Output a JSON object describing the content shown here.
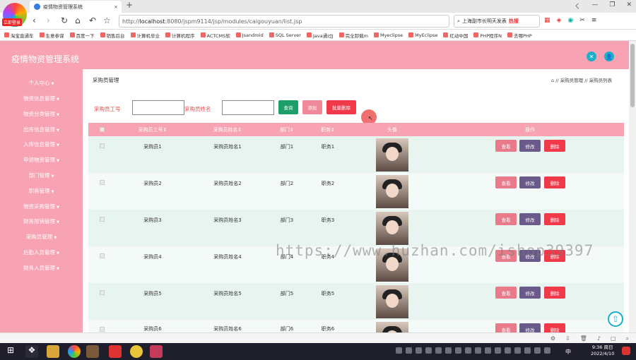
{
  "browser": {
    "tab_title": "疫情物资管理系统",
    "tab_close": "×",
    "new_tab": "+",
    "logo_label": "立即登录",
    "url_prefix": "http://",
    "url_host": "localhost",
    "url_rest": ":8080/jspm9114/jsp/modules/caigouyuan/list.jsp",
    "search_text": "上海副市长明天发表",
    "search_badge": "热搜",
    "window_controls": [
      "ㄑ",
      "—",
      "❐",
      "✕"
    ],
    "bookmarks": [
      "淘宝直通车",
      "生意参谋",
      "百度一下",
      "销售后台",
      "计算机毕业",
      "计算机程序",
      "ACTCMS软",
      "Jsandroid",
      "SQL Server",
      "Java通过J",
      "完全卸载m",
      "Myeclipse",
      "MyEclipse",
      "红动中国",
      "PHP程序N",
      "去哪PHP"
    ]
  },
  "app": {
    "title": "疫情物资管理系统",
    "header_icon1": "✕",
    "header_icon2": "👤"
  },
  "sidebar": {
    "items": [
      {
        "label": "个人中心"
      },
      {
        "label": "物资信息管理"
      },
      {
        "label": "物资分类管理"
      },
      {
        "label": "出库信息管理"
      },
      {
        "label": "入库信息管理"
      },
      {
        "label": "申领物资管理"
      },
      {
        "label": "部门管理"
      },
      {
        "label": "职务管理"
      },
      {
        "label": "物资采购管理"
      },
      {
        "label": "财务报销管理"
      },
      {
        "label": "采购员管理"
      },
      {
        "label": "后勤人员管理"
      },
      {
        "label": "财务人员管理"
      }
    ]
  },
  "page": {
    "heading": "采购员管理",
    "breadcrumb": "⌂ // 采购员管理 // 采购员列表"
  },
  "search": {
    "label_id": "采购员工号",
    "label_name": "采购员姓名",
    "query_btn": "查询",
    "add_btn": "添加",
    "batch_delete_btn": "批量删除"
  },
  "table": {
    "headers": [
      "采购员工号⇕",
      "采购员姓名⇕",
      "部门⇕",
      "职务⇕",
      "头像",
      "操作"
    ],
    "actions": {
      "view": "查看",
      "edit": "修改",
      "delete": "删除"
    },
    "rows": [
      {
        "id": "采购员1",
        "name": "采购员姓名1",
        "dept": "部门1",
        "job": "职务1"
      },
      {
        "id": "采购员2",
        "name": "采购员姓名2",
        "dept": "部门2",
        "job": "职务2"
      },
      {
        "id": "采购员3",
        "name": "采购员姓名3",
        "dept": "部门3",
        "job": "职务3"
      },
      {
        "id": "采购员4",
        "name": "采购员姓名4",
        "dept": "部门4",
        "job": "职务4"
      },
      {
        "id": "采购员5",
        "name": "采购员姓名5",
        "dept": "部门5",
        "job": "职务5"
      },
      {
        "id": "采购员6",
        "name": "采购员姓名6",
        "dept": "部门6",
        "job": "职务6"
      }
    ]
  },
  "watermark": "https://www.huzhan.com/ishop39397",
  "taskbar": {
    "ime": "中",
    "time": "9:36 周日",
    "date": "2022/4/10"
  },
  "colors": {
    "theme_pink": "#f7a3b3",
    "query_green": "#1e9e6a",
    "add_pink": "#f08a9a",
    "delete_red": "#f03a4a",
    "view_pink": "#e87a8a",
    "edit_purple": "#6a5a8a"
  }
}
